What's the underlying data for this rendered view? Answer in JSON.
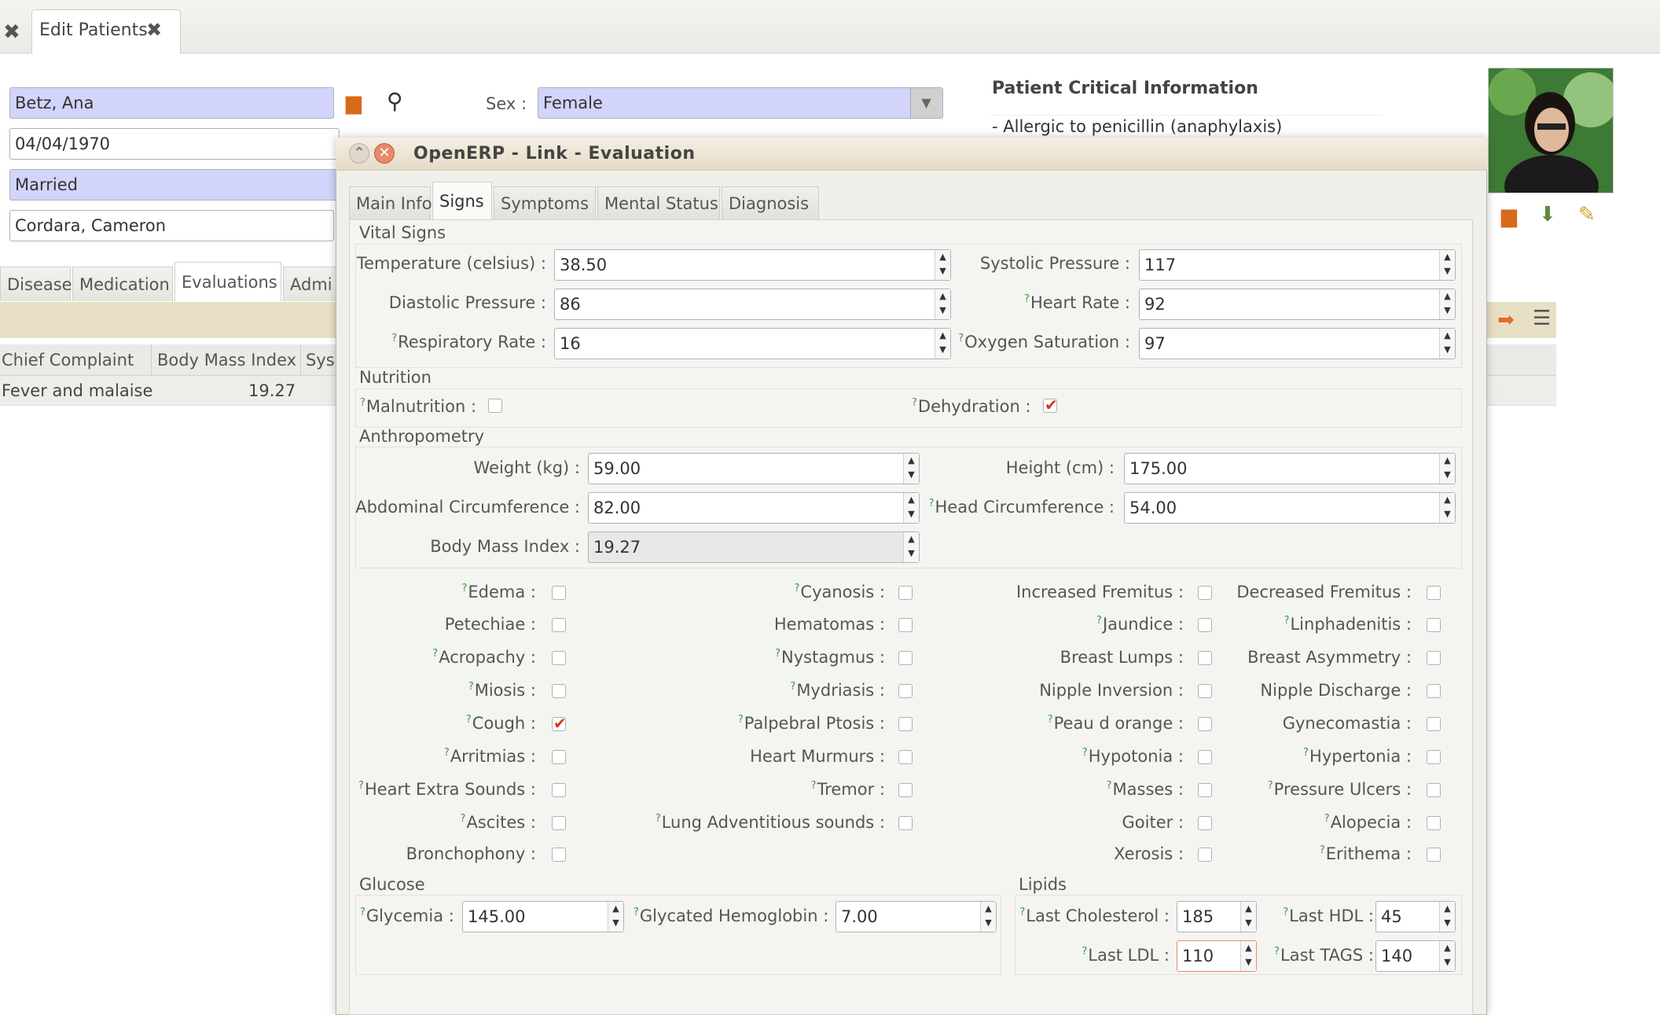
{
  "tabs": {
    "top": {
      "label": "Edit Patients"
    }
  },
  "patient": {
    "name": "Betz, Ana",
    "dob": "04/04/1970",
    "marital_status": "Married",
    "family": "Cordara, Cameron",
    "sex_label": "Sex :",
    "sex_value": "Female"
  },
  "critical": {
    "title": "Patient Critical Information",
    "allergy": "- Allergic to penicillin (anaphylaxis)"
  },
  "patient_tabs": [
    "Diseases",
    "Medication",
    "Evaluations",
    "Admi"
  ],
  "evaluations_grid": {
    "headers": [
      "Chief Complaint",
      "Body Mass Index",
      "Sys"
    ],
    "rows": [
      {
        "chief_complaint": "Fever and malaise",
        "bmi": "19.27"
      }
    ]
  },
  "dialog": {
    "title": "OpenERP - Link - Evaluation",
    "tabs": [
      "Main Info",
      "Signs",
      "Symptoms",
      "Mental Status",
      "Diagnosis"
    ],
    "active_tab": "Signs",
    "vital": {
      "title": "Vital Signs",
      "temperature_label": "Temperature (celsius) :",
      "temperature": "38.50",
      "systolic_label": "Systolic Pressure :",
      "systolic": "117",
      "diastolic_label": "Diastolic Pressure :",
      "diastolic": "86",
      "heart_rate_label": "Heart Rate :",
      "heart_rate": "92",
      "resp_label": "Respiratory Rate :",
      "resp": "16",
      "oxygen_label": "Oxygen Saturation :",
      "oxygen": "97"
    },
    "nutrition": {
      "title": "Nutrition",
      "malnutrition_label": "Malnutrition :",
      "malnutrition": false,
      "dehydration_label": "Dehydration :",
      "dehydration": true
    },
    "anthropometry": {
      "title": "Anthropometry",
      "weight_label": "Weight (kg) :",
      "weight": "59.00",
      "height_label": "Height (cm) :",
      "height": "175.00",
      "abdominal_label": "Abdominal Circumference :",
      "abdominal": "82.00",
      "head_label": "Head Circumference :",
      "head": "54.00",
      "bmi_label": "Body Mass Index :",
      "bmi": "19.27"
    },
    "signs": {
      "col1": [
        "Edema :",
        "Petechiae :",
        "Acropachy :",
        "Miosis :",
        "Cough :",
        "Arritmias :",
        "Heart Extra Sounds :",
        "Ascites :",
        "Bronchophony :"
      ],
      "col2": [
        "Cyanosis :",
        "Hematomas :",
        "Nystagmus :",
        "Mydriasis :",
        "Palpebral Ptosis :",
        "Heart Murmurs :",
        "Tremor :",
        "Lung Adventitious sounds :"
      ],
      "col3": [
        "Increased Fremitus :",
        "Jaundice :",
        "Breast Lumps :",
        "Nipple Inversion :",
        "Peau d orange :",
        "Hypotonia :",
        "Masses :",
        "Goiter :",
        "Xerosis :"
      ],
      "col4": [
        "Decreased Fremitus :",
        "Linphadenitis :",
        "Breast Asymmetry :",
        "Nipple Discharge :",
        "Gynecomastia :",
        "Hypertonia :",
        "Pressure Ulcers :",
        "Alopecia :",
        "Erithema :"
      ]
    },
    "glucose": {
      "title": "Glucose",
      "glycemia_label": "Glycemia :",
      "glycemia": "145.00",
      "hba1c_label": "Glycated Hemoglobin :",
      "hba1c": "7.00"
    },
    "lipids": {
      "title": "Lipids",
      "chol_label": "Last Cholesterol :",
      "chol": "185",
      "hdl_label": "Last HDL :",
      "hdl": "45",
      "ldl_label": "Last LDL :",
      "ldl": "110",
      "tags_label": "Last TAGS :",
      "tags": "140"
    }
  },
  "colors": {
    "required_bg": "#d2d4fb",
    "title_bar": "#e4dcc7",
    "check_red": "#cc3a1f",
    "help_green": "#3a9a3a"
  },
  "icons": [
    "close-icon",
    "folder-icon",
    "search-icon",
    "dropdown-arrow-icon",
    "help-icon",
    "checkbox-check-icon",
    "arrow-right-icon",
    "list-icon",
    "save-icon",
    "brush-icon"
  ]
}
